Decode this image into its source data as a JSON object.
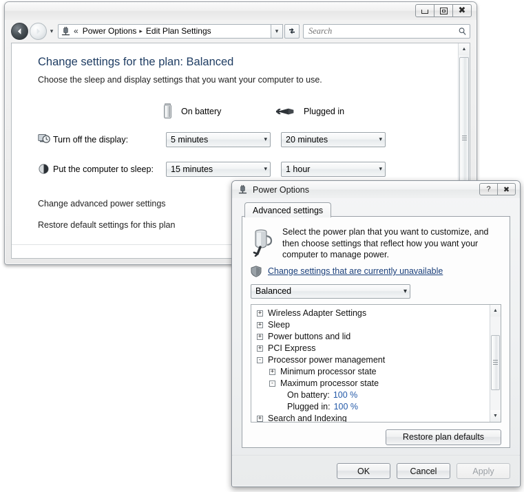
{
  "explorer": {
    "window_controls": [
      {
        "name": "minimize",
        "glyph": "minimize-icon"
      },
      {
        "name": "maximize",
        "glyph": "maximize-icon"
      },
      {
        "name": "close",
        "glyph": "close-icon",
        "label": "✖"
      }
    ],
    "nav": {
      "back_tooltip": "Back",
      "forward_tooltip": "Forward",
      "history_glyph": "▾"
    },
    "address": {
      "icon": "power-plug-icon",
      "chevrons": "«",
      "crumbs": [
        "Power Options",
        "Edit Plan Settings"
      ],
      "separator": "▸",
      "dropdown_glyph": "▾"
    },
    "refresh_tooltip": "Refresh",
    "search": {
      "placeholder": "Search",
      "icon": "search-icon"
    },
    "page": {
      "heading": "Change settings for the plan: Balanced",
      "subheading": "Choose the sleep and display settings that you want your computer to use.",
      "columns": [
        {
          "icon": "battery-icon",
          "label": "On battery"
        },
        {
          "icon": "power-plug-icon",
          "label": "Plugged in"
        }
      ],
      "rows": [
        {
          "icon": "display-clock-icon",
          "label": "Turn off the display:",
          "on_battery": "5 minutes",
          "plugged_in": "20 minutes"
        },
        {
          "icon": "sleep-moon-icon",
          "label": "Put the computer to sleep:",
          "on_battery": "15 minutes",
          "plugged_in": "1 hour"
        }
      ],
      "links": [
        "Change advanced power settings",
        "Restore default settings for this plan"
      ]
    },
    "scrollbar": {
      "up_glyph": "▲",
      "down_glyph": "▼"
    }
  },
  "dialog": {
    "title": "Power Options",
    "title_icon": "power-plug-icon",
    "titlebar_buttons": [
      {
        "name": "help",
        "label": "?"
      },
      {
        "name": "close",
        "label": "✖"
      }
    ],
    "tabs": [
      {
        "label": "Advanced settings",
        "selected": true
      }
    ],
    "description": "Select the power plan that you want to customize, and then choose settings that reflect how you want your computer to manage power.",
    "description_icon": "power-plug-icon",
    "shield_icon": "shield-icon",
    "shield_link": "Change settings that are currently unavailable",
    "plan_combo": {
      "value": "Balanced",
      "dropdown_glyph": "▾"
    },
    "tree": [
      {
        "level": 0,
        "expander": "+",
        "label": "Wireless Adapter Settings"
      },
      {
        "level": 0,
        "expander": "+",
        "label": "Sleep"
      },
      {
        "level": 0,
        "expander": "+",
        "label": "Power buttons and lid"
      },
      {
        "level": 0,
        "expander": "+",
        "label": "PCI Express"
      },
      {
        "level": 0,
        "expander": "-",
        "label": "Processor power management"
      },
      {
        "level": 1,
        "expander": "+",
        "label": "Minimum processor state"
      },
      {
        "level": 1,
        "expander": "-",
        "label": "Maximum processor state"
      },
      {
        "level": 2,
        "expander": "",
        "label": "On battery:",
        "value": "100 %"
      },
      {
        "level": 2,
        "expander": "",
        "label": "Plugged in:",
        "value": "100 %"
      },
      {
        "level": 0,
        "expander": "+",
        "label": "Search and Indexing"
      }
    ],
    "tree_scrollbar": {
      "up_glyph": "▲",
      "down_glyph": "▼"
    },
    "restore_button": "Restore plan defaults",
    "buttons": [
      {
        "label": "OK",
        "enabled": true
      },
      {
        "label": "Cancel",
        "enabled": true
      },
      {
        "label": "Apply",
        "enabled": false
      }
    ]
  },
  "colors": {
    "heading_blue": "#1f3d63",
    "link_blue": "#1a3f7a",
    "value_blue": "#2359a8"
  }
}
